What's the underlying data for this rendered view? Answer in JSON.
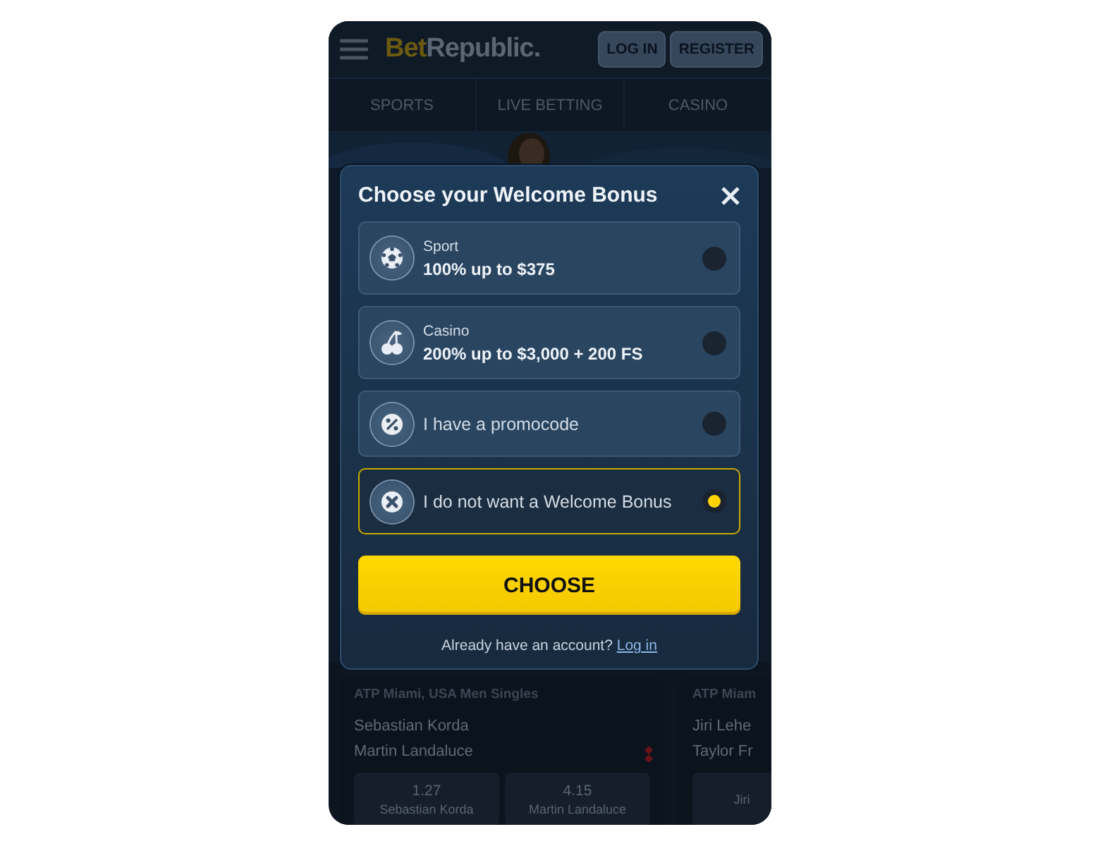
{
  "header": {
    "logo": {
      "lead": "Bet",
      "rest": "Republic."
    },
    "buttons": [
      "LOG IN",
      "REGISTER"
    ]
  },
  "nav": [
    {
      "label": "SPORTS",
      "selected": false
    },
    {
      "label": "LIVE BETTING",
      "selected": false
    },
    {
      "label": "CASINO",
      "selected": false
    }
  ],
  "matches": [
    {
      "tournament": "ATP Miami, USA Men Singles",
      "players": [
        "Sebastian Korda",
        "Martin Landaluce"
      ],
      "odds": [
        {
          "price": "1.27",
          "name": "Sebastian Korda"
        },
        {
          "price": "4.15",
          "name": "Martin Landaluce"
        }
      ]
    },
    {
      "tournament": "ATP Miam",
      "players": [
        "Jiri Lehe",
        "Taylor Fr"
      ],
      "odds": [
        {
          "name": "Jiri"
        }
      ]
    }
  ],
  "modal": {
    "title": "Choose your Welcome Bonus",
    "options": [
      {
        "kind": "sport",
        "label": "Sport",
        "offer": "100% up to $375",
        "selected": false
      },
      {
        "kind": "casino",
        "label": "Casino",
        "offer": "200% up to $3,000 + 200 FS",
        "selected": false
      },
      {
        "kind": "promo",
        "label": "I have a promocode",
        "selected": false
      },
      {
        "kind": "none",
        "label": "I do not want a Welcome Bonus",
        "selected": true
      }
    ],
    "button": "CHOOSE",
    "footer": {
      "text": "Already have an account?",
      "link": "Log in"
    }
  }
}
